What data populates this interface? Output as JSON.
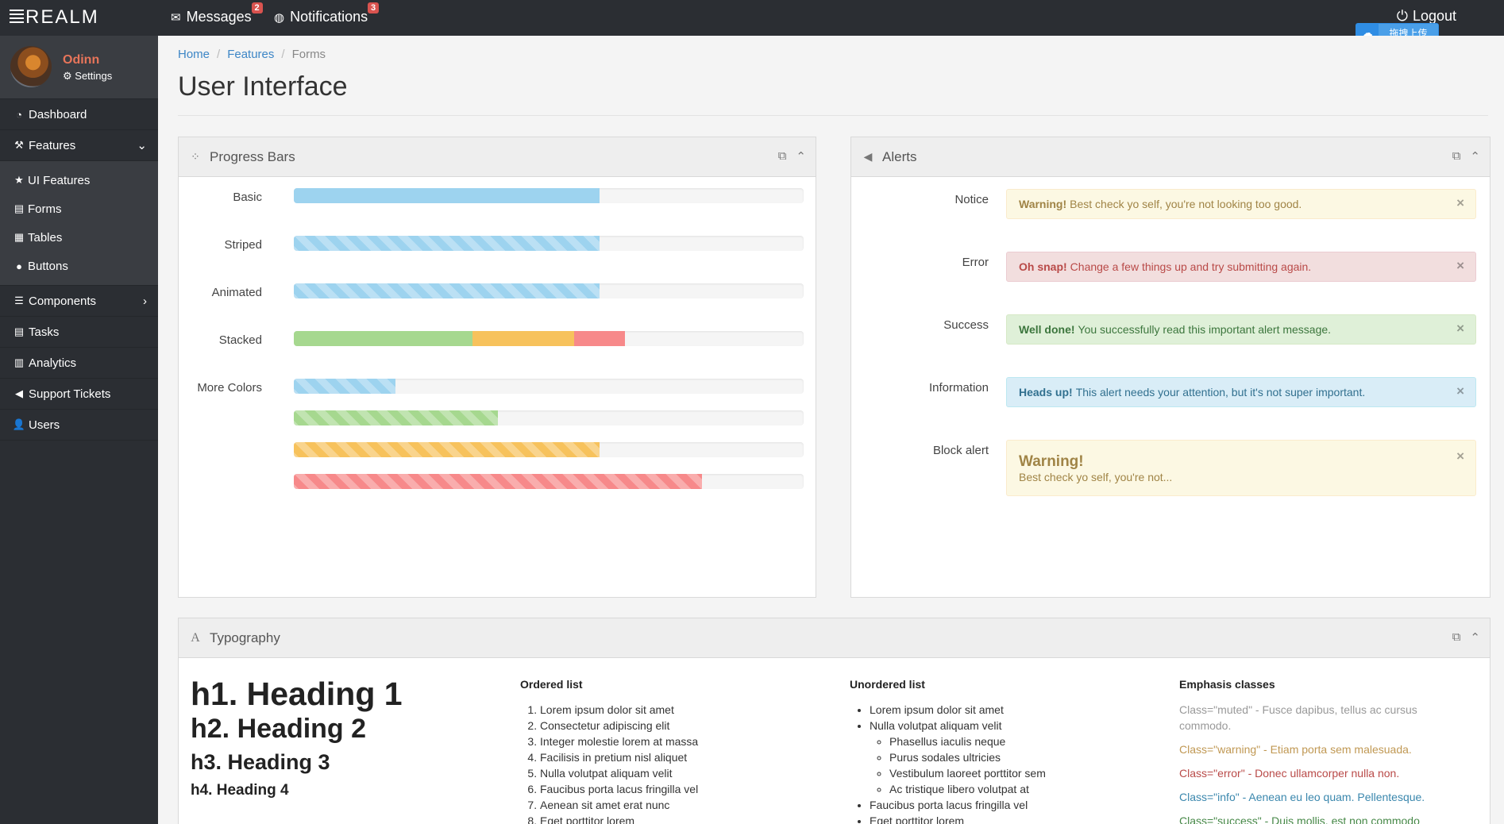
{
  "brand": "REALM",
  "topbar": {
    "messages_label": "Messages",
    "messages_count": "2",
    "notifications_label": "Notifications",
    "notifications_count": "3",
    "logout_label": "Logout",
    "upload_label": "拖拽上传"
  },
  "sidebar": {
    "user_name": "Odinn",
    "settings_label": "Settings",
    "items": [
      {
        "label": "Dashboard"
      },
      {
        "label": "Features"
      },
      {
        "label": "Components"
      },
      {
        "label": "Tasks"
      },
      {
        "label": "Analytics"
      },
      {
        "label": "Support Tickets"
      },
      {
        "label": "Users"
      }
    ],
    "sub_items": [
      {
        "label": "UI Features"
      },
      {
        "label": "Forms"
      },
      {
        "label": "Tables"
      },
      {
        "label": "Buttons"
      }
    ]
  },
  "breadcrumb": [
    "Home",
    "Features",
    "Forms"
  ],
  "page_title": "User Interface",
  "progress_panel": {
    "title": "Progress Bars",
    "rows": [
      {
        "label": "Basic",
        "value": 60
      },
      {
        "label": "Striped",
        "value": 60
      },
      {
        "label": "Animated",
        "value": 60
      },
      {
        "label": "Stacked",
        "segments": [
          35,
          20,
          10
        ]
      },
      {
        "label": "More Colors",
        "values": [
          20,
          40,
          60,
          80
        ]
      }
    ]
  },
  "alerts_panel": {
    "title": "Alerts",
    "close_symbol": "×",
    "items": [
      {
        "label": "Notice",
        "strong": "Warning!",
        "text": "Best check yo self, you're not looking too good."
      },
      {
        "label": "Error",
        "strong": "Oh snap!",
        "text": "Change a few things up and try submitting again."
      },
      {
        "label": "Success",
        "strong": "Well done!",
        "text": "You successfully read this important alert message."
      },
      {
        "label": "Information",
        "strong": "Heads up!",
        "text": "This alert needs your attention, but it's not super important."
      },
      {
        "label": "Block alert",
        "strong": "Warning!",
        "text": "Best check yo self, you're not..."
      }
    ]
  },
  "typography_panel": {
    "title": "Typography",
    "headings": [
      "h1. Heading 1",
      "h2. Heading 2",
      "h3. Heading 3",
      "h4. Heading 4"
    ],
    "ordered_title": "Ordered list",
    "ordered": [
      "Lorem ipsum dolor sit amet",
      "Consectetur adipiscing elit",
      "Integer molestie lorem at massa",
      "Facilisis in pretium nisl aliquet",
      "Nulla volutpat aliquam velit",
      "Faucibus porta lacus fringilla vel",
      "Aenean sit amet erat nunc",
      "Eget porttitor lorem"
    ],
    "unordered_title": "Unordered list",
    "unordered": [
      "Lorem ipsum dolor sit amet",
      "Nulla volutpat aliquam velit"
    ],
    "unordered_nested": [
      "Phasellus iaculis neque",
      "Purus sodales ultricies",
      "Vestibulum laoreet porttitor sem",
      "Ac tristique libero volutpat at"
    ],
    "unordered_after": [
      "Faucibus porta lacus fringilla vel",
      "Eget porttitor lorem"
    ],
    "emphasis_title": "Emphasis classes",
    "emphasis": [
      {
        "text": "Class=\"muted\" - Fusce dapibus, tellus ac cursus commodo.",
        "color": "#999999"
      },
      {
        "text": "Class=\"warning\" - Etiam porta sem malesuada.",
        "color": "#c09853"
      },
      {
        "text": "Class=\"error\" - Donec ullamcorper nulla non.",
        "color": "#b94a48"
      },
      {
        "text": "Class=\"info\" - Aenean eu leo quam. Pellentesque.",
        "color": "#3a87ad"
      },
      {
        "text": "Class=\"success\" - Duis mollis, est non commodo",
        "color": "#468847"
      }
    ]
  }
}
